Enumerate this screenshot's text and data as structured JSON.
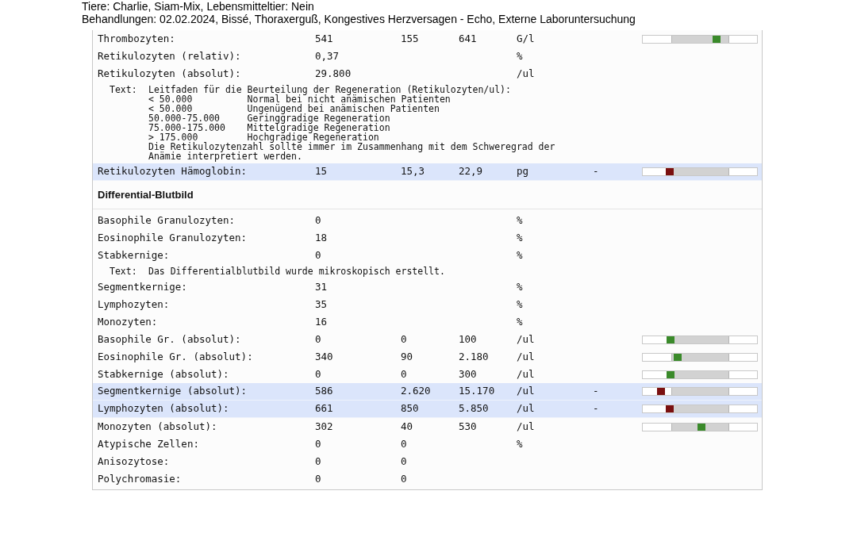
{
  "header": {
    "lines": [
      "Tiere: Charlie, Siam-Mix, Lebensmitteltier: Nein",
      "Behandlungen: 02.02.2024, Bissé, Thoraxerguß, Kongestives Herzversagen - Echo, Externe Laboruntersuchung"
    ]
  },
  "rows": [
    {
      "kind": "result",
      "name": "Thrombozyten:",
      "value": "541",
      "min": "155",
      "max": "641",
      "unit": "G/l",
      "out_of_range": false,
      "level": 0.64
    },
    {
      "kind": "result",
      "name": "Retikulozyten (relativ):",
      "value": "0,37",
      "unit": "%",
      "out_of_range": false
    },
    {
      "kind": "result",
      "name": "Retikulozyten (absolut):",
      "value": "29.800",
      "unit": "/ul",
      "out_of_range": false
    },
    {
      "kind": "text",
      "label": "Text:",
      "lines": [
        "Leitfaden für die Beurteilung der Regeneration (Retikulozyten/ul):",
        "< 50.000          Normal bei nicht anämischen Patienten",
        "< 50.000          Ungenügend bei anämischen Patienten",
        "50.000-75.000     Geringgradige Regeneration",
        "75.000-175.000    Mittelgradige Regeneration",
        "> 175.000         Hochgradige Regeneration",
        "Die Retikulozytenzahl sollte immer im Zusammenhang mit dem Schweregrad der",
        "Anämie interpretiert werden."
      ]
    },
    {
      "kind": "result",
      "name": "Retikulozyten Hämoglobin:",
      "value": "15",
      "min": "15,3",
      "max": "22,9",
      "unit": "pg",
      "flag": "-",
      "out_of_range": true,
      "level": 0.23
    },
    {
      "kind": "heading",
      "name": "Differential-Blutbild"
    },
    {
      "kind": "result",
      "name": "Basophile Granulozyten:",
      "value": "0",
      "unit": "%",
      "out_of_range": false
    },
    {
      "kind": "result",
      "name": "Eosinophile Granulozyten:",
      "value": "18",
      "unit": "%",
      "out_of_range": false
    },
    {
      "kind": "result",
      "name": "Stabkernige:",
      "value": "0",
      "unit": "%",
      "out_of_range": false
    },
    {
      "kind": "text",
      "label": "Text:",
      "lines": [
        "Das Differentialblutbild wurde mikroskopisch erstellt."
      ]
    },
    {
      "kind": "result",
      "name": "Segmentkernige:",
      "value": "31",
      "unit": "%",
      "out_of_range": false
    },
    {
      "kind": "result",
      "name": "Lymphozyten:",
      "value": "35",
      "unit": "%",
      "out_of_range": false
    },
    {
      "kind": "result",
      "name": "Monozyten:",
      "value": "16",
      "unit": "%",
      "out_of_range": false
    },
    {
      "kind": "result",
      "name": "Basophile Gr. (absolut):",
      "value": "0",
      "min": "0",
      "max": "100",
      "unit": "/ul",
      "out_of_range": false,
      "level": 0.24
    },
    {
      "kind": "result",
      "name": "Eosinophile Gr. (absolut):",
      "value": "340",
      "min": "90",
      "max": "2.180",
      "unit": "/ul",
      "out_of_range": false,
      "level": 0.3
    },
    {
      "kind": "result",
      "name": "Stabkernige (absolut):",
      "value": "0",
      "min": "0",
      "max": "300",
      "unit": "/ul",
      "out_of_range": false,
      "level": 0.24
    },
    {
      "kind": "result",
      "name": "Segmentkernige (absolut):",
      "value": "586",
      "min": "2.620",
      "max": "15.170",
      "unit": "/ul",
      "flag": "-",
      "out_of_range": true,
      "level": 0.16
    },
    {
      "kind": "result",
      "name": "Lymphozyten (absolut):",
      "value": "661",
      "min": "850",
      "max": "5.850",
      "unit": "/ul",
      "flag": "-",
      "out_of_range": true,
      "level": 0.23
    },
    {
      "kind": "result",
      "name": "Monozyten (absolut):",
      "value": "302",
      "min": "40",
      "max": "530",
      "unit": "/ul",
      "out_of_range": false,
      "level": 0.51
    },
    {
      "kind": "result",
      "name": "Atypische Zellen:",
      "value": "0",
      "min": "0",
      "unit": "%",
      "out_of_range": false
    },
    {
      "kind": "result",
      "name": "Anisozytose:",
      "value": "0",
      "min": "0",
      "out_of_range": false
    },
    {
      "kind": "result",
      "name": "Polychromasie:",
      "value": "0",
      "min": "0",
      "out_of_range": false
    }
  ]
}
